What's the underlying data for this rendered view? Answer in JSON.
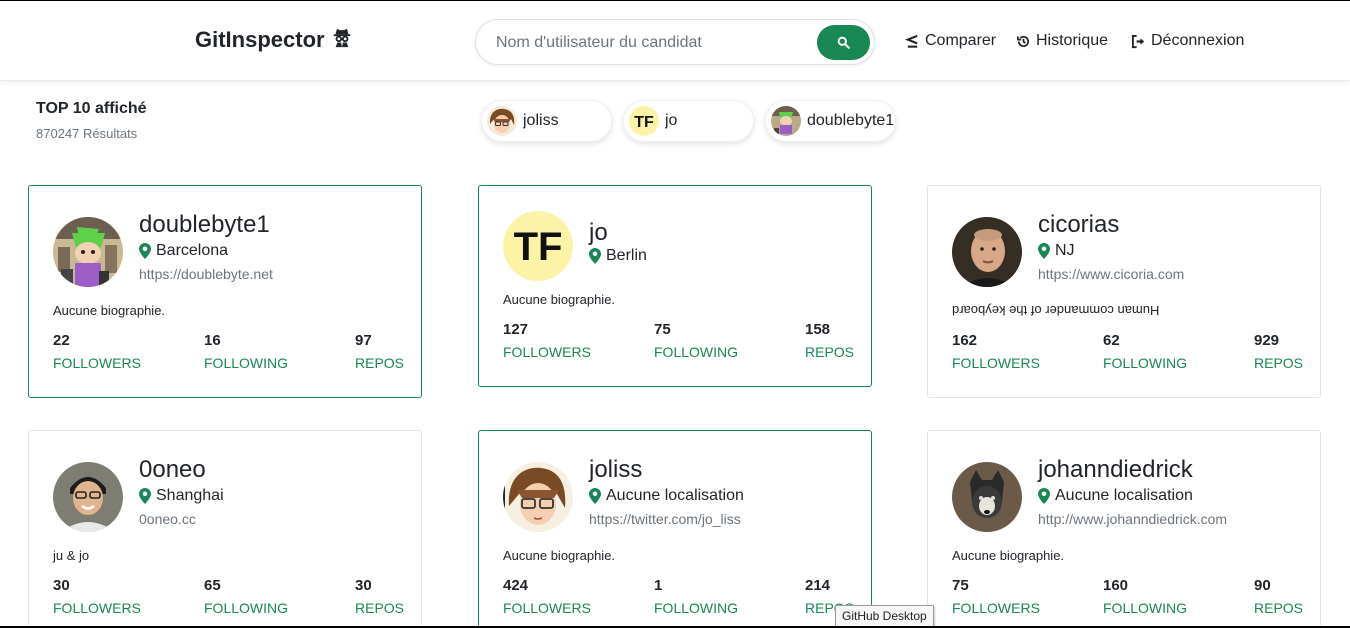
{
  "app": {
    "brand": "GitInspector",
    "search_placeholder": "Nom d'utilisateur du candidat",
    "nav": {
      "compare": "Comparer",
      "history": "Historique",
      "logout": "Déconnexion"
    },
    "accent": "#198754"
  },
  "summary": {
    "title": "TOP 10 affiché",
    "count": "870247 Résultats"
  },
  "chips": [
    {
      "label": "joliss",
      "avatar": "joliss-avatar"
    },
    {
      "label": "jo",
      "avatar": "tf-logo-avatar"
    },
    {
      "label": "doublebyte1",
      "avatar": "doublebyte-avatar"
    }
  ],
  "cards": [
    {
      "username": "doublebyte1",
      "location": "Barcelona",
      "url": "https://doublebyte.net",
      "bio": "Aucune biographie.",
      "followers": "22",
      "following": "16",
      "repos": "97",
      "followers_label": "FOLLOWERS",
      "following_label": "FOLLOWING",
      "repos_label": "REPOS",
      "selected": true,
      "avatar": "doublebyte-avatar"
    },
    {
      "username": "jo",
      "location": "Berlin",
      "url": "",
      "bio": "Aucune biographie.",
      "followers": "127",
      "following": "75",
      "repos": "158",
      "followers_label": "FOLLOWERS",
      "following_label": "FOLLOWING",
      "repos_label": "REPOS",
      "selected": true,
      "avatar": "tf-logo-avatar"
    },
    {
      "username": "cicorias",
      "location": "NJ",
      "url": "https://www.cicoria.com",
      "bio": "Human commander of the keyboard",
      "followers": "162",
      "following": "62",
      "repos": "929",
      "followers_label": "FOLLOWERS",
      "following_label": "FOLLOWING",
      "repos_label": "REPOS",
      "selected": false,
      "avatar": "cicorias-avatar"
    },
    {
      "username": "0oneo",
      "location": "Shanghai",
      "url": "0oneo.cc",
      "bio": "ju & jo",
      "followers": "30",
      "following": "65",
      "repos": "30",
      "followers_label": "FOLLOWERS",
      "following_label": "FOLLOWING",
      "repos_label": "REPOS",
      "selected": false,
      "avatar": "0oneo-avatar"
    },
    {
      "username": "joliss",
      "location": "Aucune localisation",
      "url": "https://twitter.com/jo_liss",
      "bio": "Aucune biographie.",
      "followers": "424",
      "following": "1",
      "repos": "214",
      "followers_label": "FOLLOWERS",
      "following_label": "FOLLOWING",
      "repos_label": "REPOS",
      "selected": true,
      "avatar": "joliss-avatar"
    },
    {
      "username": "johanndiedrick",
      "location": "Aucune localisation",
      "url": "http://www.johanndiedrick.com",
      "bio": "Aucune biographie.",
      "followers": "75",
      "following": "160",
      "repos": "90",
      "followers_label": "FOLLOWERS",
      "following_label": "FOLLOWING",
      "repos_label": "REPOS",
      "selected": false,
      "avatar": "johanndiedrick-avatar"
    }
  ],
  "tooltip": "GitHub Desktop"
}
